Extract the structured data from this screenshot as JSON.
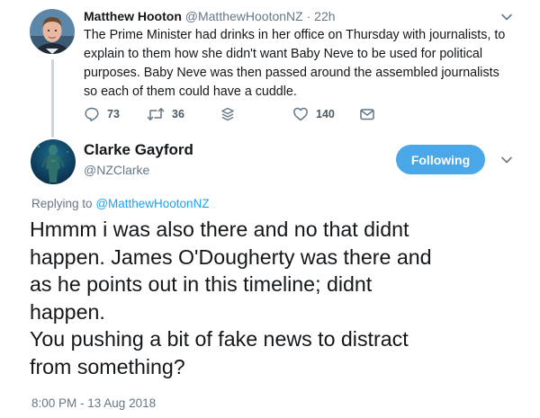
{
  "parent_tweet": {
    "name": "Matthew Hooton",
    "handle": "@MatthewHootonNZ",
    "separator": "·",
    "time": "22h",
    "text": "The Prime Minister had drinks in her office on Thursday with journalists, to explain to them how she didn't want Baby Neve to be used for political purposes. Baby Neve was then passed around the assembled journalists so each of them could have a cuddle.",
    "avatar_icon": "person-photo-avatar",
    "actions": {
      "reply": {
        "icon": "reply-icon",
        "count": "73"
      },
      "retweet": {
        "icon": "retweet-icon",
        "count": "36"
      },
      "stack": {
        "icon": "stack-icon"
      },
      "like": {
        "icon": "heart-icon",
        "count": "140"
      },
      "message": {
        "icon": "envelope-icon"
      }
    }
  },
  "main_tweet": {
    "name": "Clarke Gayford",
    "handle": "@NZClarke",
    "follow_label": "Following",
    "avatar_icon": "underwater-statue-avatar",
    "replying_prefix": "Replying to",
    "replying_to": "@MatthewHootonNZ",
    "text_lines": [
      "Hmmm i was also there and no that didnt",
      "happen. James O'Dougherty was there and",
      "as he points out in this timeline; didnt",
      "happen.",
      "You pushing a bit of fake news to  distract",
      "from something?"
    ],
    "timestamp": "8:00 PM - 13 Aug 2018"
  },
  "colors": {
    "accent": "#1da1f2",
    "follow_button": "#4aa8e8",
    "text": "#14171a",
    "muted": "#657786",
    "thread_line": "#c9d6df"
  }
}
